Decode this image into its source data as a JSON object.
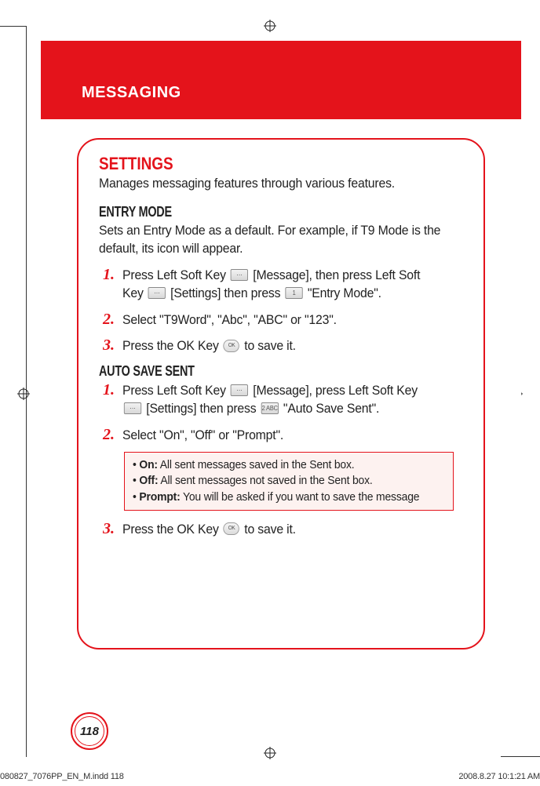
{
  "header": {
    "title": "MESSAGING"
  },
  "settings": {
    "title": "SETTINGS",
    "desc": "Manages messaging features through various features."
  },
  "entry_mode": {
    "title": "ENTRY MODE",
    "desc": "Sets an Entry Mode as a default. For example, if T9 Mode is the default, its icon will appear.",
    "steps": {
      "s1a": "Press Left Soft Key ",
      "s1b": " [Message], then press Left Soft Key ",
      "s1c": " [Settings] then press ",
      "s1d": " \"Entry Mode\".",
      "s2": "Select \"T9Word\", \"Abc\", \"ABC\" or \"123\".",
      "s3a": "Press the OK Key ",
      "s3b": " to save it."
    }
  },
  "auto_save": {
    "title": "AUTO SAVE SENT",
    "steps": {
      "s1a": "Press Left Soft Key ",
      "s1b": " [Message], press Left Soft Key ",
      "s1c": " [Settings] then press ",
      "s1d": " \"Auto Save Sent\".",
      "s2": "Select \"On\", \"Off\" or \"Prompt\".",
      "s3a": "Press the OK Key ",
      "s3b": " to save it."
    },
    "note": {
      "on_label": "On:",
      "on_text": " All sent messages saved in the Sent box.",
      "off_label": "Off:",
      "off_text": " All sent messages not saved in the Sent box.",
      "prompt_label": "Prompt:",
      "prompt_text": " You will be asked if you want to save the message"
    }
  },
  "key_labels": {
    "one": "1",
    "two": "2 ABC",
    "ok": "OK"
  },
  "page_number": "118",
  "footer": {
    "left": "080827_7076PP_EN_M.indd   118",
    "right": "2008.8.27   10:1:21 AM"
  }
}
